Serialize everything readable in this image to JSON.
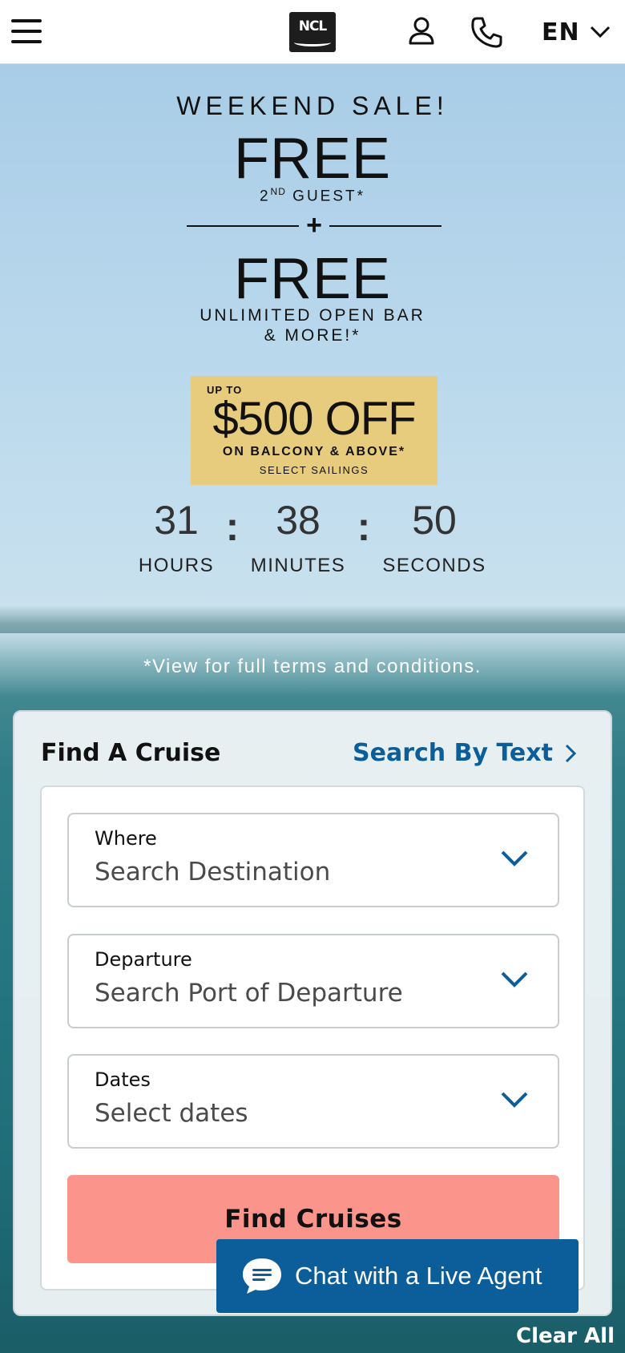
{
  "header": {
    "logo_text": "NCL",
    "language": "EN"
  },
  "promo": {
    "headline": "WEEKEND SALE!",
    "free_1": "FREE",
    "guest_prefix": "2",
    "guest_sup": "ND",
    "guest_suffix": "GUEST*",
    "plus": "+",
    "free_2": "FREE",
    "bar_line1": "UNLIMITED OPEN BAR",
    "bar_line2": "& MORE!*",
    "offer_upto": "UP TO",
    "offer_amount": "$500 OFF",
    "offer_detail": "ON BALCONY & ABOVE*",
    "offer_select": "SELECT SAILINGS",
    "offer_color": "#e8cc7d"
  },
  "countdown": {
    "hours": "31",
    "minutes": "38",
    "seconds": "50",
    "separator": ":",
    "hours_label": "HOURS",
    "minutes_label": "MINUTES",
    "seconds_label": "SECONDS"
  },
  "terms": "*View for full terms and conditions.",
  "finder": {
    "title": "Find A Cruise",
    "search_by_text": "Search By Text",
    "fields": [
      {
        "label": "Where",
        "value": "Search Destination"
      },
      {
        "label": "Departure",
        "value": "Search Port of Departure"
      },
      {
        "label": "Dates",
        "value": "Select dates"
      }
    ],
    "button": "Find Cruises",
    "button_color": "#fb958b",
    "link_color": "#0b5e9a"
  },
  "chat": {
    "label": "Chat with a Live Agent"
  },
  "clear_all": "Clear All"
}
